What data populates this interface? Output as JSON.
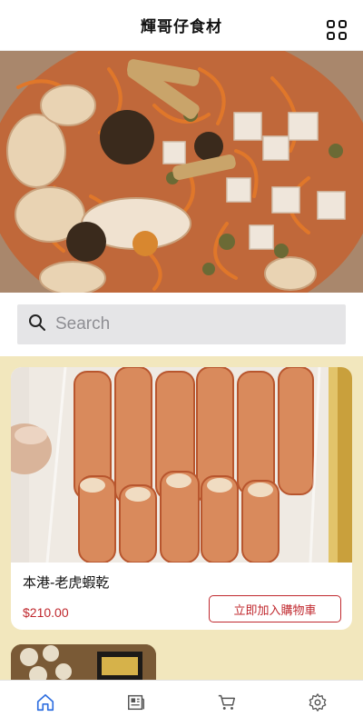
{
  "header": {
    "title": "輝哥仔食材",
    "menu_icon": "grid-icon"
  },
  "search": {
    "placeholder": "Search",
    "icon": "search-icon"
  },
  "products": [
    {
      "name": "本港-老虎蝦乾",
      "price": "$210.00",
      "add_to_cart_label": "立即加入購物車"
    }
  ],
  "tabbar": {
    "items": [
      {
        "icon": "home-icon",
        "active": true
      },
      {
        "icon": "news-icon",
        "active": false
      },
      {
        "icon": "cart-icon",
        "active": false
      },
      {
        "icon": "settings-icon",
        "active": false
      }
    ]
  },
  "colors": {
    "accent": "#c0282e",
    "list_background": "#f2e7bd",
    "active_tab": "#2f6fe0",
    "inactive_tab": "#555555"
  }
}
